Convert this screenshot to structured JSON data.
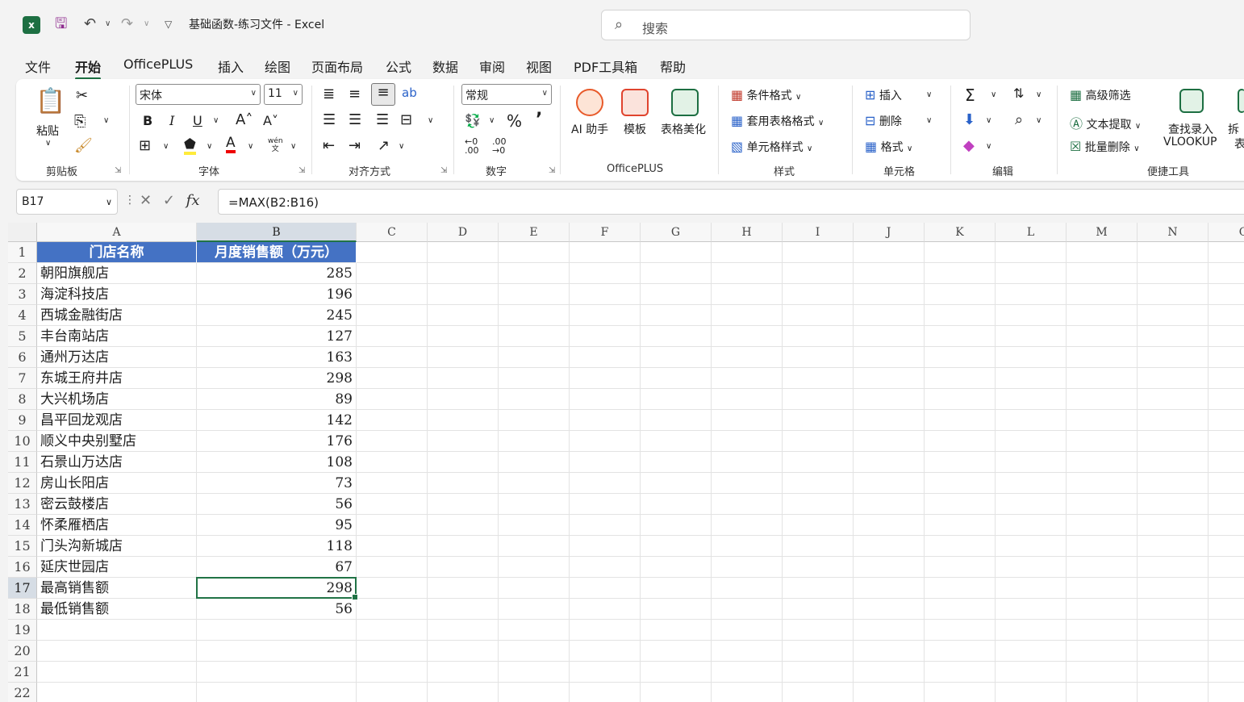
{
  "app": {
    "logo_letter": "x",
    "doc_title": "基础函数-练习文件  -  Excel"
  },
  "search": {
    "placeholder": "搜索"
  },
  "menu": {
    "tabs": [
      "文件",
      "开始",
      "OfficePLUS",
      "插入",
      "绘图",
      "页面布局",
      "公式",
      "数据",
      "审阅",
      "视图",
      "PDF工具箱",
      "帮助"
    ],
    "active": "开始"
  },
  "ribbon": {
    "clipboard": {
      "label": "剪贴板",
      "paste": "粘贴"
    },
    "font": {
      "label": "字体",
      "name": "宋体",
      "size": "11",
      "phonetic": "wén"
    },
    "alignment": {
      "label": "对齐方式"
    },
    "number": {
      "label": "数字",
      "format": "常规"
    },
    "officeplus": {
      "label": "OfficePLUS",
      "ai": "AI 助手",
      "template": "模板",
      "beautify": "表格美化"
    },
    "styles": {
      "label": "样式",
      "conditional": "条件格式",
      "table": "套用表格格式",
      "cell": "单元格样式"
    },
    "cells": {
      "label": "单元格",
      "insert": "插入",
      "delete": "删除",
      "format": "格式"
    },
    "editing": {
      "label": "编辑"
    },
    "tools": {
      "label": "便捷工具",
      "filter": "高级筛选",
      "extract": "文本提取",
      "bulk_delete": "批量删除",
      "lookup_line1": "查找录入",
      "lookup_line2": "VLOOKUP",
      "split_partial": "拆",
      "split_partial2": "表"
    }
  },
  "formula_bar": {
    "name_box": "B17",
    "formula": "=MAX(B2:B16)"
  },
  "sheet": {
    "columns": [
      "A",
      "B",
      "C",
      "D",
      "E",
      "F",
      "G",
      "H",
      "I",
      "J",
      "K",
      "L",
      "M",
      "N",
      "O"
    ],
    "selected_col": "B",
    "selected_row": 17,
    "header": [
      "门店名称",
      "月度销售额（万元）"
    ],
    "rows": [
      [
        "朝阳旗舰店",
        "285"
      ],
      [
        "海淀科技店",
        "196"
      ],
      [
        "西城金融街店",
        "245"
      ],
      [
        "丰台南站店",
        "127"
      ],
      [
        "通州万达店",
        "163"
      ],
      [
        "东城王府井店",
        "298"
      ],
      [
        "大兴机场店",
        "89"
      ],
      [
        "昌平回龙观店",
        "142"
      ],
      [
        "顺义中央别墅店",
        "176"
      ],
      [
        "石景山万达店",
        "108"
      ],
      [
        "房山长阳店",
        "73"
      ],
      [
        "密云鼓楼店",
        "56"
      ],
      [
        "怀柔雁栖店",
        "95"
      ],
      [
        "门头沟新城店",
        "118"
      ],
      [
        "延庆世园店",
        "67"
      ],
      [
        "最高销售额",
        "298"
      ],
      [
        "最低销售额",
        "56"
      ]
    ],
    "row_numbers": [
      "1",
      "2",
      "3",
      "4",
      "5",
      "6",
      "7",
      "8",
      "9",
      "10",
      "11",
      "12",
      "13",
      "14",
      "15",
      "16",
      "17",
      "18",
      "19",
      "20",
      "21",
      "22"
    ]
  }
}
